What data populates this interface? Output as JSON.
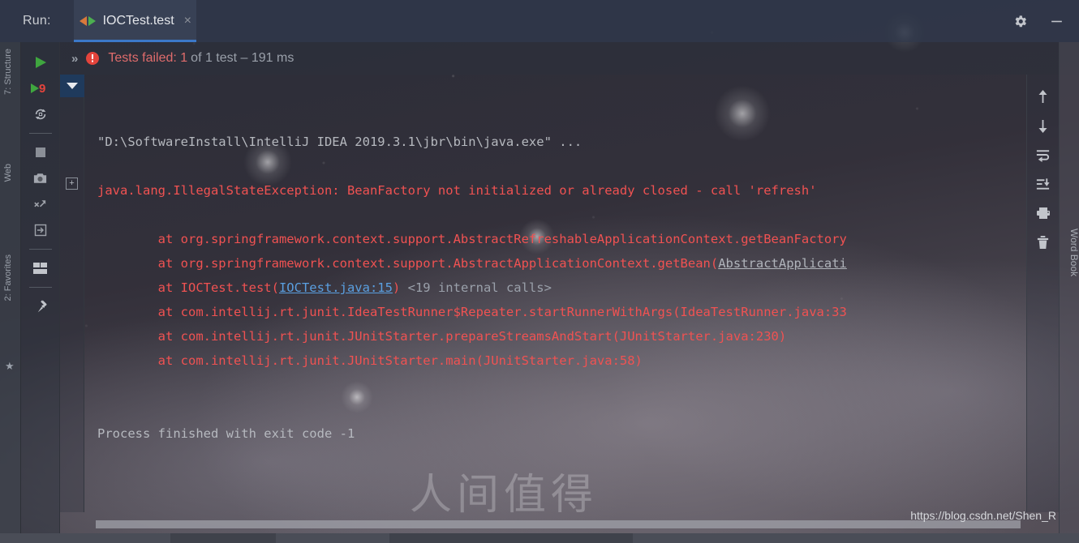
{
  "window": {
    "run_label": "Run:",
    "tab_title": "IOCTest.test",
    "tab_close": "×",
    "settings_icon": "gear-icon",
    "minimize_icon": "minimize-icon"
  },
  "status": {
    "expand_chevrons": "»",
    "failed_prefix": "Tests failed: 1",
    "detail": " of 1 test – 191 ms",
    "error_icon": "error-circle-icon",
    "fail_color": "#e06c6c",
    "dim_color": "#9aa0aa"
  },
  "run_toolbar": {
    "items": [
      {
        "name": "rerun-button",
        "icon": "play-icon"
      },
      {
        "name": "rerun-failed-tests-button",
        "icon": "play-with-9-icon",
        "badge": "9"
      },
      {
        "name": "toggle-auto-test-button",
        "icon": "refresh-cycle-icon"
      },
      {
        "name": "stop-button",
        "icon": "stop-square-icon"
      },
      {
        "name": "export-snapshot-button",
        "icon": "camera-icon"
      },
      {
        "name": "import-test-results-button",
        "icon": "import-results-icon"
      },
      {
        "name": "open-in-editor-button",
        "icon": "enter-box-icon"
      },
      {
        "name": "layout-settings-button",
        "icon": "layout-icon"
      },
      {
        "name": "pin-tab-button",
        "icon": "pin-icon"
      }
    ]
  },
  "console_toolbar": {
    "items": [
      {
        "name": "scroll-up-button",
        "icon": "arrow-up-icon"
      },
      {
        "name": "scroll-down-button",
        "icon": "arrow-down-icon"
      },
      {
        "name": "soft-wrap-button",
        "icon": "soft-wrap-icon"
      },
      {
        "name": "scroll-to-end-button",
        "icon": "scroll-to-end-icon"
      },
      {
        "name": "print-button",
        "icon": "printer-icon"
      },
      {
        "name": "clear-all-button",
        "icon": "trash-icon"
      }
    ]
  },
  "left_rail": {
    "items": [
      {
        "label": "7: Structure",
        "name": "tool-window-structure"
      },
      {
        "label": "Web",
        "name": "tool-window-web"
      },
      {
        "label": "2: Favorites",
        "name": "tool-window-favorites"
      }
    ]
  },
  "right_rail": {
    "label": "Word Book",
    "name": "tool-window-word-book"
  },
  "gutter": {
    "collapse_icon": "collapse-triangle-icon",
    "expand_label": "+"
  },
  "console": {
    "lines": [
      {
        "id": "cmd",
        "kind": "system",
        "segments": [
          {
            "text": "\"D:\\SoftwareInstall\\IntelliJ IDEA 2019.3.1\\jbr\\bin\\java.exe\" ...",
            "style": "sys"
          }
        ]
      },
      {
        "id": "blank1",
        "kind": "blank",
        "segments": []
      },
      {
        "id": "exception",
        "kind": "error",
        "segments": [
          {
            "text": "java.lang.IllegalStateException: BeanFactory not initialized or already closed - call 'refresh'",
            "style": "err"
          }
        ]
      },
      {
        "id": "blank2",
        "kind": "blank",
        "segments": []
      },
      {
        "id": "st1",
        "kind": "error",
        "segments": [
          {
            "text": "\tat org.springframework.context.support.AbstractRefreshableApplicationContext.getBeanFactory",
            "style": "err"
          }
        ]
      },
      {
        "id": "st2",
        "kind": "error",
        "segments": [
          {
            "text": "\tat org.springframework.context.support.AbstractApplicationContext.getBean(",
            "style": "err"
          },
          {
            "text": "AbstractApplicati",
            "style": "link2"
          }
        ]
      },
      {
        "id": "st3",
        "kind": "error",
        "segments": [
          {
            "text": "\tat IOCTest.test(",
            "style": "err"
          },
          {
            "text": "IOCTest.java:15",
            "style": "link"
          },
          {
            "text": ")",
            "style": "err"
          },
          {
            "text": " <19 internal calls>",
            "style": "dim"
          }
        ]
      },
      {
        "id": "st4",
        "kind": "error",
        "segments": [
          {
            "text": "\tat com.intellij.rt.junit.IdeaTestRunner$Repeater.startRunnerWithArgs(IdeaTestRunner.java:33",
            "style": "err"
          }
        ]
      },
      {
        "id": "st5",
        "kind": "error",
        "segments": [
          {
            "text": "\tat com.intellij.rt.junit.JUnitStarter.prepareStreamsAndStart(JUnitStarter.java:230)",
            "style": "err"
          }
        ]
      },
      {
        "id": "st6",
        "kind": "error",
        "segments": [
          {
            "text": "\tat com.intellij.rt.junit.JUnitStarter.main(JUnitStarter.java:58)",
            "style": "err"
          }
        ]
      },
      {
        "id": "blank3",
        "kind": "blank",
        "segments": []
      },
      {
        "id": "blank4",
        "kind": "blank",
        "segments": []
      },
      {
        "id": "exit",
        "kind": "system",
        "segments": [
          {
            "text": "Process finished with exit code -1",
            "style": "sys"
          }
        ]
      }
    ]
  },
  "watermarks": {
    "chinese": "人间值得",
    "url": "https://blog.csdn.net/Shen_R"
  },
  "colors": {
    "error_red": "#f05252",
    "link_blue": "#5a9fe0",
    "tab_underline": "#3c78c8",
    "run_green": "#4caf50",
    "badge_red": "#e74c3c"
  }
}
